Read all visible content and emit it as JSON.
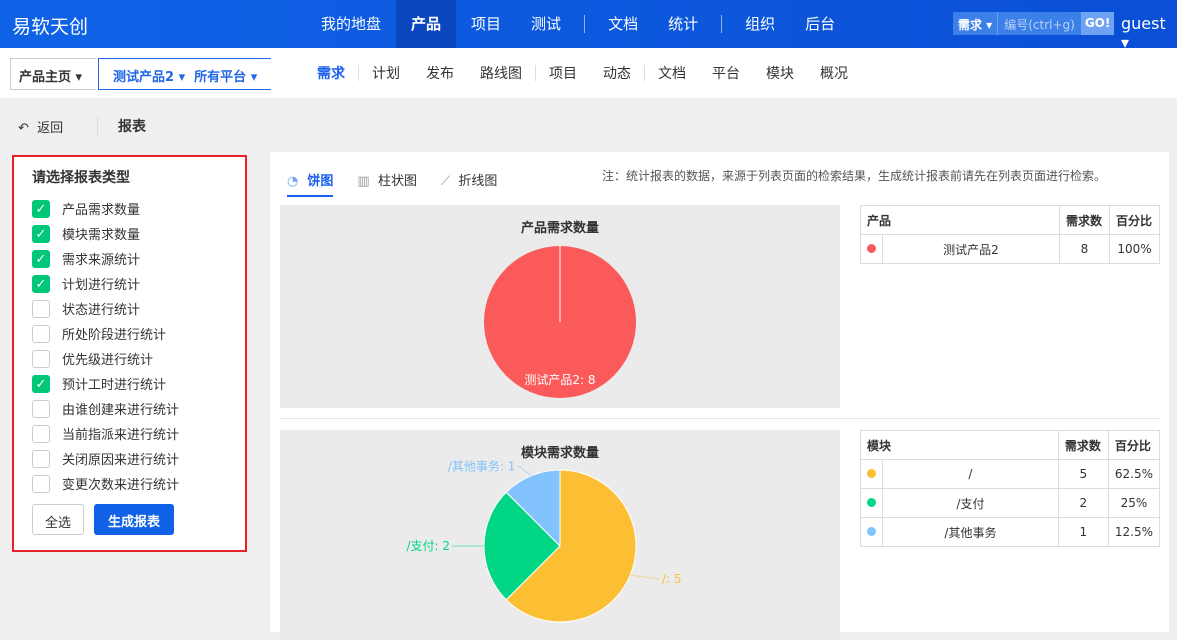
{
  "header": {
    "logo": "易软天创",
    "nav": [
      "我的地盘",
      "产品",
      "项目",
      "测试",
      "文档",
      "统计",
      "组织",
      "后台"
    ],
    "active": 1,
    "search_type": "需求 ▾",
    "search_placeholder": "编号(ctrl+g)",
    "go": "GO!",
    "user": "guest ▾"
  },
  "crumbs": {
    "home": "产品主页 ▾",
    "product": "测试产品2 ▾",
    "platform": "所有平台 ▾"
  },
  "subnav": [
    "需求",
    "计划",
    "发布",
    "路线图",
    "项目",
    "动态",
    "文档",
    "平台",
    "模块",
    "概况"
  ],
  "toolbar": {
    "back": "返回",
    "title": "报表"
  },
  "left": {
    "heading": "请选择报表类型",
    "items": [
      {
        "label": "产品需求数量",
        "checked": true
      },
      {
        "label": "模块需求数量",
        "checked": true
      },
      {
        "label": "需求来源统计",
        "checked": true
      },
      {
        "label": "计划进行统计",
        "checked": true
      },
      {
        "label": "状态进行统计",
        "checked": false
      },
      {
        "label": "所处阶段进行统计",
        "checked": false
      },
      {
        "label": "优先级进行统计",
        "checked": false
      },
      {
        "label": "预计工时进行统计",
        "checked": true
      },
      {
        "label": "由谁创建来进行统计",
        "checked": false
      },
      {
        "label": "当前指派来进行统计",
        "checked": false
      },
      {
        "label": "关闭原因来进行统计",
        "checked": false
      },
      {
        "label": "变更次数来进行统计",
        "checked": false
      }
    ],
    "select_all": "全选",
    "generate": "生成报表"
  },
  "tabs": [
    "饼图",
    "柱状图",
    "折线图"
  ],
  "note": "注：统计报表的数据，来源于列表页面的检索结果，生成统计报表前请先在列表页面进行检索。",
  "chart_data": [
    {
      "type": "pie",
      "title": "产品需求数量",
      "categories": [
        "测试产品2"
      ],
      "values": [
        8
      ],
      "colors": [
        "#fa5a5a"
      ],
      "table": {
        "headers": [
          "产品",
          "需求数",
          "百分比"
        ],
        "rows": [
          [
            "测试产品2",
            "8",
            "100%"
          ]
        ]
      }
    },
    {
      "type": "pie",
      "title": "模块需求数量",
      "categories": [
        "/",
        "/支付",
        "/其他事务"
      ],
      "values": [
        5,
        2,
        1
      ],
      "colors": [
        "#fcbf34",
        "#00d683",
        "#82c3fd"
      ],
      "table": {
        "headers": [
          "模块",
          "需求数",
          "百分比"
        ],
        "rows": [
          [
            "/",
            "5",
            "62.5%"
          ],
          [
            "/支付",
            "2",
            "25%"
          ],
          [
            "/其他事务",
            "1",
            "12.5%"
          ]
        ]
      }
    }
  ]
}
